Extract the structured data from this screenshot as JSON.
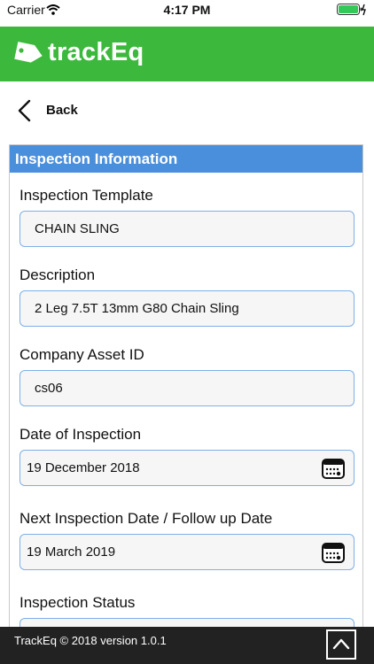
{
  "status_bar": {
    "carrier": "Carrier",
    "time": "4:17 PM"
  },
  "app": {
    "name": "trackEq",
    "brand_color": "#3cb93c"
  },
  "nav": {
    "back_label": "Back"
  },
  "section": {
    "title": "Inspection Information",
    "header_color": "#4a8fdb"
  },
  "fields": {
    "template": {
      "label": "Inspection Template",
      "value": "CHAIN SLING"
    },
    "description": {
      "label": "Description",
      "value": "2 Leg 7.5T 13mm G80 Chain Sling"
    },
    "asset_id": {
      "label": "Company Asset ID",
      "value": "cs06"
    },
    "inspection_date": {
      "label": "Date of Inspection",
      "value": "19 December 2018"
    },
    "next_date": {
      "label": "Next Inspection Date / Follow up Date",
      "value": "19 March 2019"
    },
    "status": {
      "label": "Inspection Status",
      "value": ""
    }
  },
  "footer": {
    "text": "TrackEq © 2018 version 1.0.1"
  },
  "icons": {
    "wifi": "wifi-icon",
    "battery": "battery-icon",
    "logo": "tag-icon",
    "back": "chevron-left-icon",
    "calendar": "calendar-icon",
    "scroll_top": "chevron-up-icon"
  }
}
